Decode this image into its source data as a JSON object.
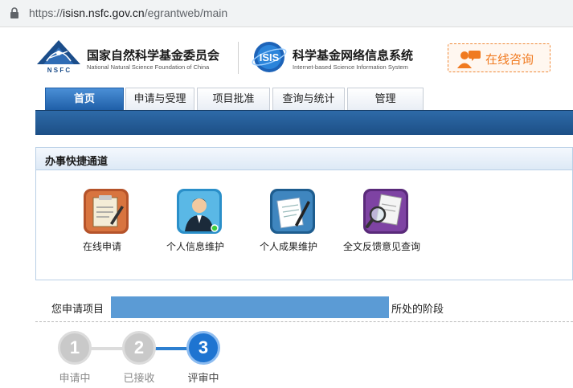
{
  "browser": {
    "url_scheme": "https://",
    "url_host": "isisn.nsfc.gov.cn",
    "url_path": "/egrantweb/main"
  },
  "header": {
    "nsfc_title": "国家自然科学基金委员会",
    "nsfc_subtitle": "National Natural Science Foundation of China",
    "nsfc_logo_text": "N S F C",
    "isis_title": "科学基金网络信息系统",
    "isis_subtitle": "Internet-based Science Information System",
    "isis_logo_text": "ISIS",
    "consult_label": "在线咨询"
  },
  "nav": {
    "tabs": [
      {
        "label": "首页",
        "active": true
      },
      {
        "label": "申请与受理",
        "active": false
      },
      {
        "label": "项目批准",
        "active": false
      },
      {
        "label": "查询与统计",
        "active": false
      },
      {
        "label": "管理",
        "active": false
      }
    ]
  },
  "quick_panel": {
    "title": "办事快捷通道",
    "items": [
      {
        "label": "在线申请",
        "icon": "online-application-icon"
      },
      {
        "label": "个人信息维护",
        "icon": "personal-info-icon"
      },
      {
        "label": "个人成果维护",
        "icon": "achievement-icon"
      },
      {
        "label": "全文反馈意见查询",
        "icon": "feedback-query-icon"
      }
    ]
  },
  "stage": {
    "prefix": "您申请项目",
    "suffix": "所处的阶段",
    "steps": [
      {
        "num": "1",
        "label": "申请中",
        "current": false
      },
      {
        "num": "2",
        "label": "已接收",
        "current": false
      },
      {
        "num": "3",
        "label": "评审中",
        "current": true
      }
    ]
  },
  "colors": {
    "nav_blue": "#1c4f86",
    "consult_orange": "#f07a20",
    "step_current": "#1e74d1",
    "redaction_blue": "#5b9bd5"
  }
}
